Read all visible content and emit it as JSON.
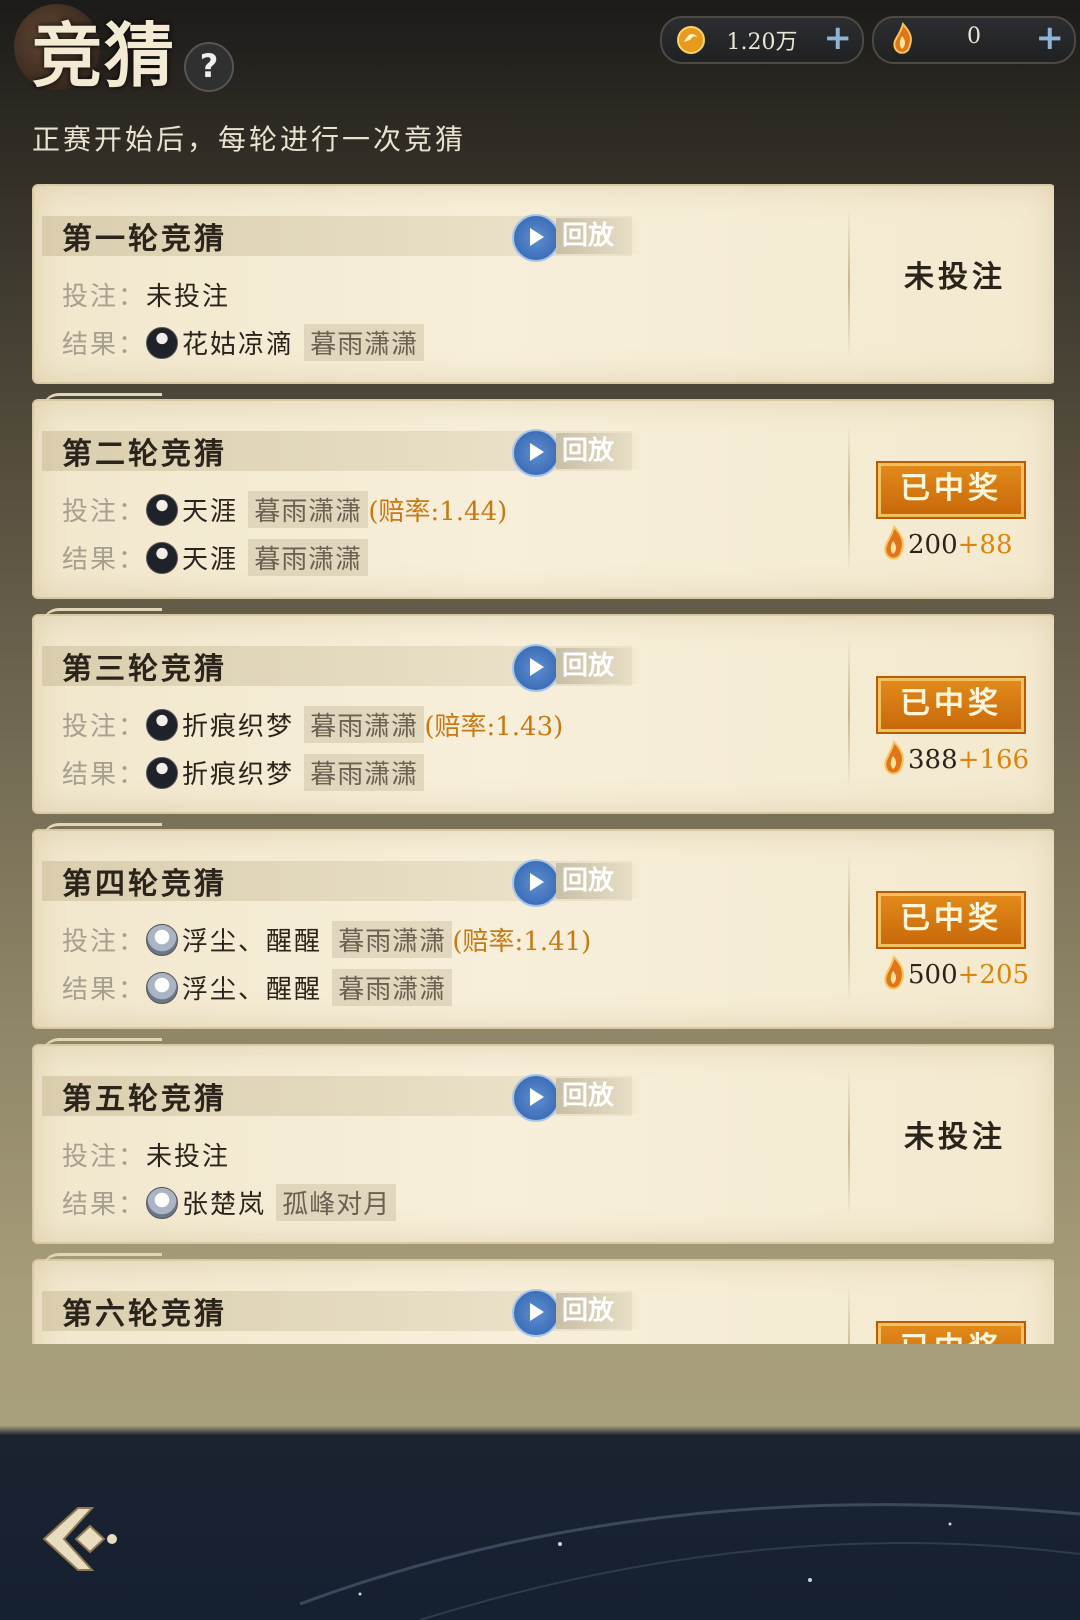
{
  "header": {
    "title": "竞猜",
    "help": "?",
    "subtitle": "正赛开始后，每轮进行一次竞猜"
  },
  "currencies": [
    {
      "icon": "gold-coin-icon",
      "value": "1.20万",
      "plus": "+"
    },
    {
      "icon": "flame-token-icon",
      "value": "0",
      "plus": "+"
    }
  ],
  "common": {
    "bet_label": "投注：",
    "result_label": "结果：",
    "replay": "回放"
  },
  "rounds": [
    {
      "title": "第一轮竞猜",
      "bet_text": "未投注",
      "bet_player": "",
      "bet_team": "",
      "bet_odds": "",
      "result_player": "花姑凉滴",
      "result_team": "暮雨潇潇",
      "status": "未投注",
      "won": false,
      "reward_base": "",
      "reward_bonus": ""
    },
    {
      "title": "第二轮竞猜",
      "bet_text": "",
      "bet_player": "天涯",
      "bet_team": "暮雨潇潇",
      "bet_odds": "(赔率:1.44)",
      "result_player": "天涯",
      "result_team": "暮雨潇潇",
      "status": "已中奖",
      "won": true,
      "reward_base": "200",
      "reward_bonus": "+88"
    },
    {
      "title": "第三轮竞猜",
      "bet_text": "",
      "bet_player": "折痕织梦",
      "bet_team": "暮雨潇潇",
      "bet_odds": "(赔率:1.43)",
      "result_player": "折痕织梦",
      "result_team": "暮雨潇潇",
      "status": "已中奖",
      "won": true,
      "reward_base": "388",
      "reward_bonus": "+166"
    },
    {
      "title": "第四轮竞猜",
      "bet_text": "",
      "bet_player": "浮尘、醒醒",
      "bet_team": "暮雨潇潇",
      "bet_odds": "(赔率:1.41)",
      "result_player": "浮尘、醒醒",
      "result_team": "暮雨潇潇",
      "status": "已中奖",
      "won": true,
      "reward_base": "500",
      "reward_bonus": "+205"
    },
    {
      "title": "第五轮竞猜",
      "bet_text": "未投注",
      "bet_player": "",
      "bet_team": "",
      "bet_odds": "",
      "result_player": "张楚岚",
      "result_team": "孤峰对月",
      "status": "未投注",
      "won": false,
      "reward_base": "",
      "reward_bonus": ""
    },
    {
      "title": "第六轮竞猜",
      "bet_text": "",
      "bet_player": "",
      "bet_team": "",
      "bet_odds": "",
      "result_player": "",
      "result_team": "",
      "status": "已中奖",
      "won": true,
      "reward_base": "",
      "reward_bonus": ""
    }
  ],
  "footer": {
    "back_icon": "back-arrow-icon"
  }
}
